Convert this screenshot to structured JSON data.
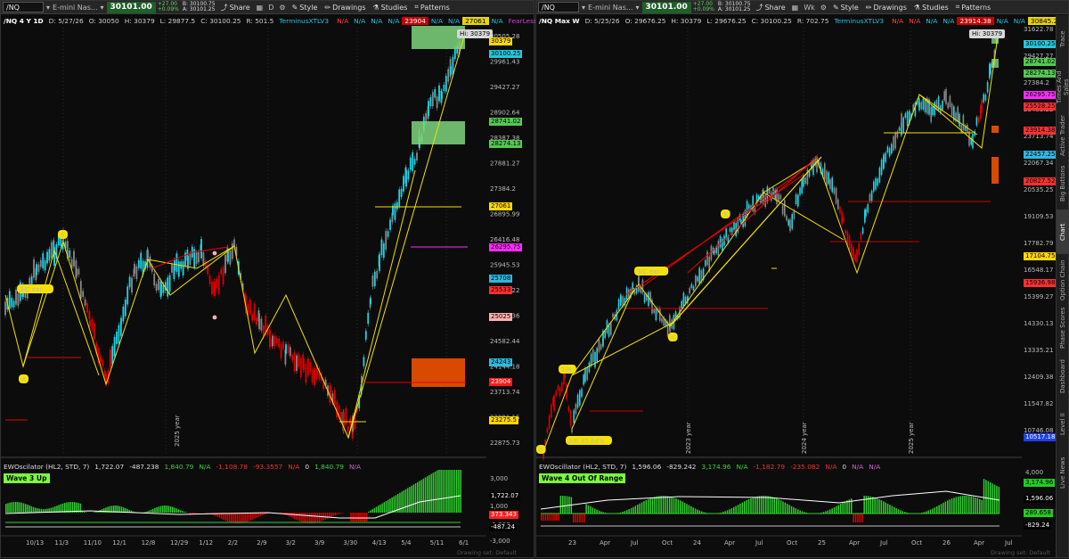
{
  "left": {
    "toolbar": {
      "symbol": "/NQ",
      "name": "E-mini Nas...",
      "price": "30101.00",
      "change_top": "+27.00",
      "change_bot": "+0.09%",
      "bid": "B: 30100.75",
      "ask": "A: 30101.25",
      "timeframe": "D",
      "share": "Share",
      "style": "Style",
      "drawings": "Drawings",
      "studies": "Studies",
      "patterns": "Patterns"
    },
    "info": {
      "title": "/NQ 4 Y 1D",
      "date": "D: 5/27/26",
      "open": "O: 30050",
      "high": "H: 30379",
      "low": "L: 29877.5",
      "close": "C: 30100.25",
      "range": "R: 501.5",
      "study": "TerminusXTLV3",
      "tags": [
        "N/A",
        "N/A",
        "N/A",
        "N/A",
        "23904",
        "N/A",
        "N/A",
        "27061",
        "N/A",
        "FearLess..."
      ]
    },
    "hi_label": "Hi: 30379",
    "price_axis": [
      "30505.28",
      "29961.43",
      "29427.27",
      "28902.64",
      "28387.38",
      "27881.27",
      "27384.2",
      "26895.99",
      "26416.48",
      "25945.53",
      "25483.22",
      "25029.36",
      "24582.44",
      "24144.18",
      "23713.74",
      "23291.15",
      "22875.73"
    ],
    "price_tags": [
      {
        "text": "30379",
        "bg": "#ffd800",
        "fg": "#000"
      },
      {
        "text": "30100.25",
        "bg": "#26c6da",
        "fg": "#000"
      },
      {
        "text": "28741.02",
        "bg": "#54c854",
        "fg": "#000"
      },
      {
        "text": "28274.13",
        "bg": "#54c854",
        "fg": "#000"
      },
      {
        "text": "27061",
        "bg": "#ffd800",
        "fg": "#000"
      },
      {
        "text": "26295.75",
        "bg": "#ff2bff",
        "fg": "#000"
      },
      {
        "text": "25708",
        "bg": "#2fb8e0",
        "fg": "#000"
      },
      {
        "text": "25533",
        "bg": "#ff3030",
        "fg": "#000"
      },
      {
        "text": "25025",
        "bg": "#ffb0b0",
        "fg": "#000"
      },
      {
        "text": "24243",
        "bg": "#2fb8e0",
        "fg": "#000"
      },
      {
        "text": "23904",
        "bg": "#ff1a1a",
        "fg": "#fff"
      },
      {
        "text": "23275.5",
        "bg": "#ffd800",
        "fg": "#000"
      }
    ],
    "wave_labels": [
      "3/C ext",
      "5",
      "4"
    ],
    "year_watermark": "2025 year",
    "oscillator": {
      "title": "EWOscilator (HL2, STD, 7)",
      "v1": "1,722.07",
      "v2": "-487.238",
      "v3": "1,840.79",
      "v4": "-1,108.78",
      "v5": "-93.3557",
      "v6": "N/A",
      "v7": "0",
      "v8": "1,840.79",
      "v9": "N/A",
      "badge": "Wave 3 Up",
      "axis": [
        "3,000",
        "1,000",
        "-1,000",
        "-3,000"
      ],
      "tags": [
        {
          "text": "1,722.07",
          "bg": "#000",
          "fg": "#fff"
        },
        {
          "text": "373.343",
          "bg": "#ff2020",
          "fg": "#fff"
        },
        {
          "text": "-487.24",
          "bg": "#000",
          "fg": "#fff"
        }
      ]
    },
    "x_axis": [
      "10/13",
      "11/3",
      "11/10",
      "12/1",
      "12/8",
      "12/29",
      "1/12",
      "2/2",
      "2/9",
      "3/2",
      "3/9",
      "3/30",
      "4/13",
      "5/4",
      "5/11",
      "6/1"
    ],
    "status": "Drawing set: Default"
  },
  "right": {
    "toolbar": {
      "symbol": "/NQ",
      "name": "E-mini Nas...",
      "price": "30101.00",
      "change_top": "+27.00",
      "change_bot": "+0.09%",
      "bid": "B: 30100.75",
      "ask": "A: 30101.25",
      "timeframe": "Wk",
      "share": "Share",
      "style": "Style",
      "drawings": "Drawings",
      "studies": "Studies",
      "patterns": "Patterns"
    },
    "info": {
      "title": "/NQ Max W",
      "date": "D: 5/25/26",
      "open": "O: 29676.25",
      "high": "H: 30379",
      "low": "L: 29676.25",
      "close": "C: 30100.25",
      "range": "R: 702.75",
      "study": "TerminusXTLV3",
      "tags": [
        "N/A",
        "N/A",
        "N/A",
        "N/A",
        "23914.38",
        "N/A",
        "N/A",
        "30845.25"
      ]
    },
    "hi_label": "Hi: 30379",
    "price_axis": [
      "31622.78",
      "29427.27",
      "27384.2",
      "25483.22",
      "23713.74",
      "22067.34",
      "20535.25",
      "19109.53",
      "17782.79",
      "16548.17",
      "15399.27",
      "14330.13",
      "13335.21",
      "12409.38",
      "11547.82",
      "10746.08"
    ],
    "price_tags": [
      {
        "text": "30100.25",
        "bg": "#26c6da",
        "fg": "#000"
      },
      {
        "text": "28741.02",
        "bg": "#54c854",
        "fg": "#000"
      },
      {
        "text": "28274.13",
        "bg": "#54c854",
        "fg": "#000"
      },
      {
        "text": "26295.75",
        "bg": "#ff2bff",
        "fg": "#000"
      },
      {
        "text": "25528.25",
        "bg": "#ff3030",
        "fg": "#000"
      },
      {
        "text": "23914.38",
        "bg": "#ff3030",
        "fg": "#000"
      },
      {
        "text": "22457.25",
        "bg": "#2fb8e0",
        "fg": "#000"
      },
      {
        "text": "20827.52",
        "bg": "#ff3030",
        "fg": "#000"
      },
      {
        "text": "17104.75",
        "bg": "#ffd800",
        "fg": "#000"
      },
      {
        "text": "15936.98",
        "bg": "#ff3030",
        "fg": "#000"
      },
      {
        "text": "10517.18",
        "bg": "#1f3fff",
        "fg": "#fff"
      }
    ],
    "wave_labels": [
      "3/C ext",
      "5",
      "4",
      "1/A",
      "2/B 85.64%",
      "0"
    ],
    "year_watermarks": [
      "2023 year",
      "2024 year",
      "2025 year"
    ],
    "oscillator": {
      "title": "EWOscillator (HL2, STD, 7)",
      "v1": "1,596.06",
      "v2": "-829.242",
      "v3": "3,174.96",
      "v4": "N/A",
      "v5": "-1,182.79",
      "v6": "-235.082",
      "v7": "N/A",
      "v8": "0",
      "v9": "N/A",
      "v10": "N/A",
      "badge": "Wave 4  Out Of Range",
      "axis": [
        "4,000",
        "2,000",
        "-2,000"
      ],
      "tags": [
        {
          "text": "3,174.96",
          "bg": "#22cc22",
          "fg": "#000"
        },
        {
          "text": "1,596.06",
          "bg": "#000",
          "fg": "#fff"
        },
        {
          "text": "289.658",
          "bg": "#22cc22",
          "fg": "#000"
        },
        {
          "text": "-829.24",
          "bg": "#000",
          "fg": "#fff"
        }
      ]
    },
    "x_axis": [
      "23",
      "Apr",
      "Jul",
      "Oct",
      "24",
      "Apr",
      "Jul",
      "Oct",
      "25",
      "Apr",
      "Jul",
      "Oct",
      "26",
      "Apr",
      "Jul"
    ],
    "status": "Drawing set: Default"
  },
  "side_tabs": [
    "Trace",
    "Times And Sales",
    "Active Trader",
    "Big Buttons",
    "Chart",
    "Option Chain",
    "Phase Scores",
    "Dashboard",
    "Level II",
    "Live News"
  ],
  "colors": {
    "up": "#22d3e6",
    "down": "#e00000",
    "trend": "#f5e100",
    "box_green": "#7ed67e",
    "box_orange": "#d84a00"
  }
}
